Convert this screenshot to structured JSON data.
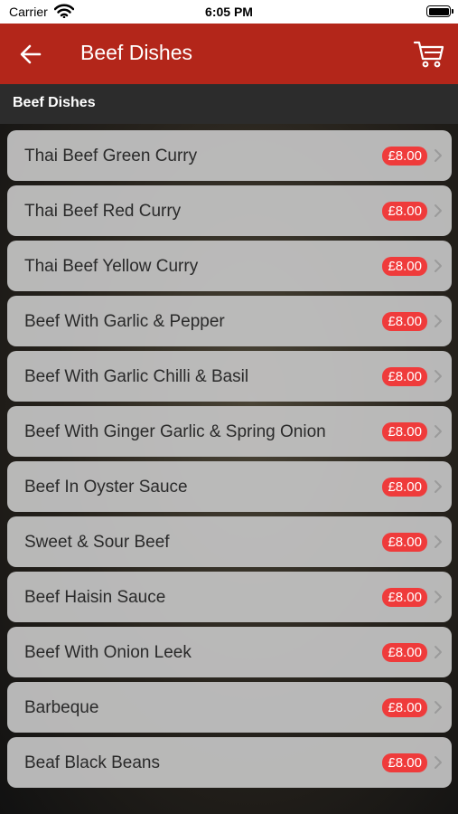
{
  "status_bar": {
    "carrier": "Carrier",
    "time": "6:05 PM"
  },
  "nav": {
    "title": "Beef Dishes",
    "back_icon": "arrow-left-icon",
    "cart_icon": "shopping-cart-icon"
  },
  "section": {
    "title": "Beef Dishes"
  },
  "items": [
    {
      "name": "Thai Beef Green Curry",
      "price": "£8.00"
    },
    {
      "name": "Thai Beef Red Curry",
      "price": "£8.00"
    },
    {
      "name": "Thai Beef Yellow Curry",
      "price": "£8.00"
    },
    {
      "name": "Beef With Garlic & Pepper",
      "price": "£8.00"
    },
    {
      "name": "Beef With Garlic Chilli & Basil",
      "price": "£8.00"
    },
    {
      "name": "Beef With Ginger Garlic & Spring Onion",
      "price": "£8.00"
    },
    {
      "name": "Beef In Oyster Sauce",
      "price": "£8.00"
    },
    {
      "name": "Sweet & Sour Beef",
      "price": "£8.00"
    },
    {
      "name": "Beef Haisin Sauce",
      "price": "£8.00"
    },
    {
      "name": "Beef With Onion Leek",
      "price": "£8.00"
    },
    {
      "name": "Barbeque",
      "price": "£8.00"
    },
    {
      "name": "Beaf Black Beans",
      "price": "£8.00"
    }
  ],
  "colors": {
    "nav_bar": "#b3261a",
    "price_badge": "#ef3b3b",
    "section_header": "#2c2c2c"
  }
}
